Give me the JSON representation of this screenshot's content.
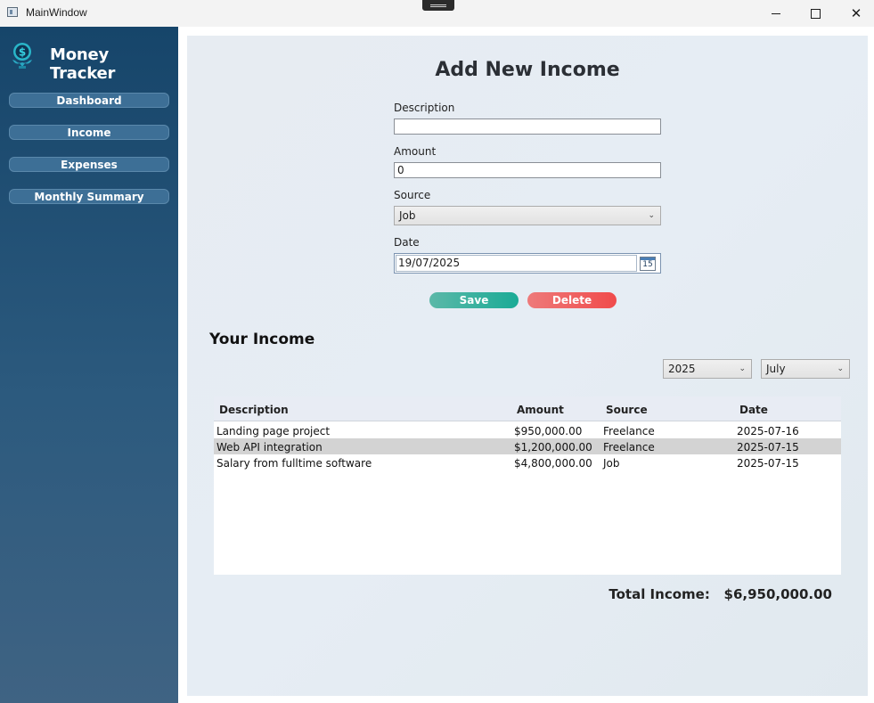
{
  "window": {
    "title": "MainWindow"
  },
  "sidebar": {
    "brand": "Money Tracker",
    "nav": [
      {
        "label": "Dashboard"
      },
      {
        "label": "Income"
      },
      {
        "label": "Expenses"
      },
      {
        "label": "Monthly Summary"
      }
    ]
  },
  "form": {
    "title": "Add New Income",
    "description_label": "Description",
    "description_value": "",
    "amount_label": "Amount",
    "amount_value": "0",
    "source_label": "Source",
    "source_value": "Job",
    "date_label": "Date",
    "date_value": "19/07/2025",
    "calendar_day": "15",
    "save_label": "Save",
    "delete_label": "Delete"
  },
  "list": {
    "title": "Your Income",
    "year_filter": "2025",
    "month_filter": "July",
    "columns": [
      "Description",
      "Amount",
      "Source",
      "Date"
    ],
    "rows": [
      {
        "description": "Landing page project",
        "amount": "$950,000.00",
        "source": "Freelance",
        "date": "2025-07-16"
      },
      {
        "description": "Web API integration",
        "amount": "$1,200,000.00",
        "source": "Freelance",
        "date": "2025-07-15"
      },
      {
        "description": "Salary from fulltime software",
        "amount": "$4,800,000.00",
        "source": "Job",
        "date": "2025-07-15"
      }
    ],
    "total_label": "Total Income:",
    "total_value": "$6,950,000.00"
  },
  "colors": {
    "sidebar_top": "#16456a",
    "sidebar_bottom": "#3f6383",
    "save": "#1aab96",
    "delete": "#f04b4b"
  },
  "icons": [
    "app-icon",
    "money-logo-icon",
    "calendar-icon",
    "chevron-down-icon"
  ]
}
